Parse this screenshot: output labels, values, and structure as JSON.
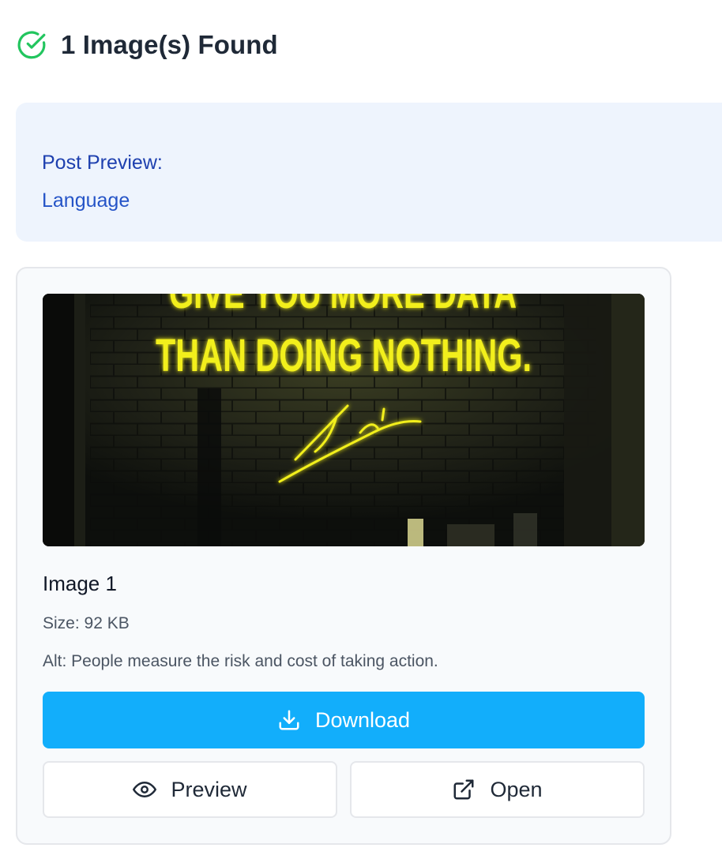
{
  "header": {
    "title": "1 Image(s) Found",
    "icon": "check-circle-icon",
    "icon_color": "#22c55e"
  },
  "post_preview": {
    "label": "Post Preview:",
    "language": "Language",
    "background": "#eef4fd"
  },
  "image_card": {
    "image_text_line1": "GIVE YOU MORE DATA",
    "image_text_line2": "THAN DOING NOTHING.",
    "title": "Image 1",
    "size": "Size: 92 KB",
    "alt": "Alt: People measure the risk and cost of taking action.",
    "download_label": "Download",
    "download_icon": "download-icon",
    "download_color": "#12aefb",
    "preview_label": "Preview",
    "preview_icon": "eye-icon",
    "open_label": "Open",
    "open_icon": "external-link-icon"
  }
}
